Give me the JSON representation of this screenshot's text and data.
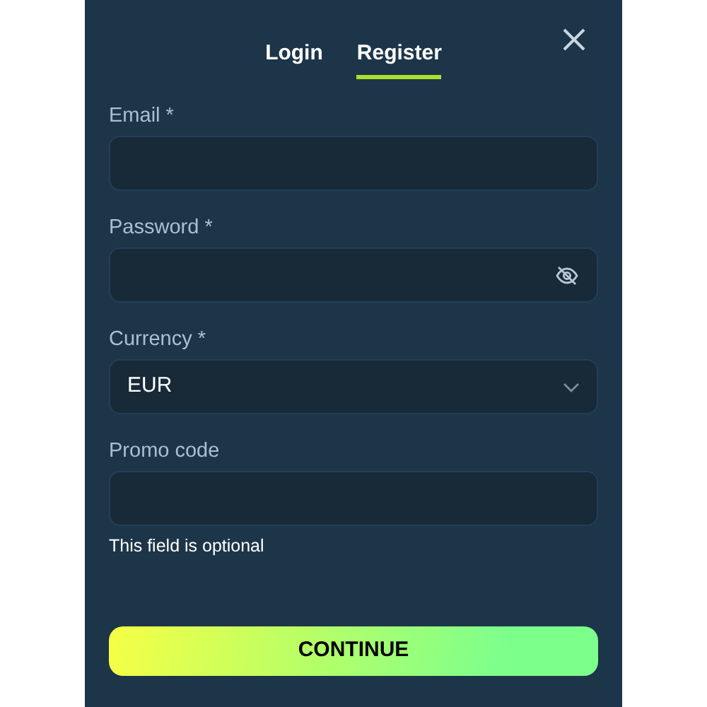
{
  "tabs": [
    {
      "label": "Login",
      "selected": false
    },
    {
      "label": "Register",
      "selected": true
    }
  ],
  "fields": [
    {
      "kind": "text",
      "label": "Email *"
    },
    {
      "kind": "password",
      "label": "Password *"
    },
    {
      "kind": "select",
      "label": "Currency *",
      "value": "EUR"
    },
    {
      "kind": "text",
      "label": "Promo code",
      "hint": "This field is optional"
    }
  ],
  "submit": "CONTINUE"
}
